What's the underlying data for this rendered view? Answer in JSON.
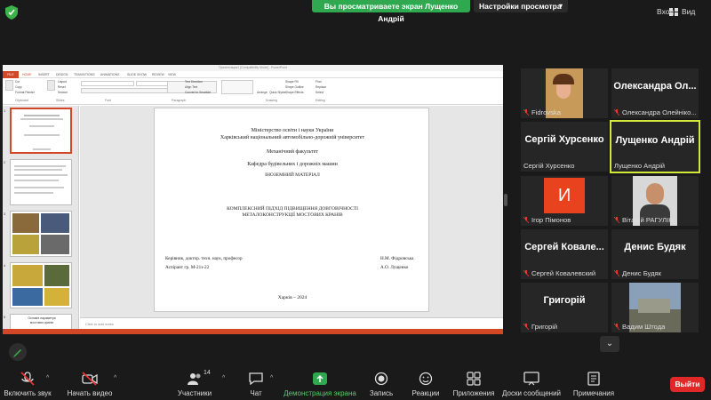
{
  "top_bar": {
    "share_banner": "Вы просматриваете экран Лущенко Андрій",
    "view_settings": "Настройки просмотра",
    "enter_label": "Вход",
    "view_label": "Вид"
  },
  "presentation": {
    "window_title": "Презентация1 [Compatibility Mode] - PowerPoint",
    "file_tab": "FILE",
    "tabs": [
      "HOME",
      "INSERT",
      "DESIGN",
      "TRANSITIONS",
      "ANIMATIONS",
      "SLIDE SHOW",
      "REVIEW",
      "VIEW"
    ],
    "ribbon_groups": [
      "Clipboard",
      "Slides",
      "Font",
      "Paragraph",
      "Drawing",
      "Editing"
    ],
    "ribbon_items": [
      "Cut",
      "Copy",
      "Format Painter",
      "Layout",
      "Reset",
      "Section",
      "Text Direction",
      "Align Text",
      "Convert to SmartArt",
      "Arrange",
      "Quick Styles",
      "Shape Fill",
      "Shape Outline",
      "Shape Effects",
      "Find",
      "Replace",
      "Select"
    ],
    "notes_placeholder": "Click to add notes",
    "slide": {
      "ministry": "Міністерство освіти і науки України",
      "university": "Харківський національний автомобільно-дорожній університет",
      "faculty": "Механічний факультет",
      "department": "Кафедра будівельних  і  дорожніх машин",
      "section": "ІНОЗЕМНИЙ МАТЕРІАЛ",
      "topic_line1": "КОМПЛЕКСНИЙ ПІДХІД ПІДВИЩЕННЯ ДОВГОВІЧНОСТІ",
      "topic_line2": "МЕТАЛОКОНСТРУКЦІЇ МОСТОВИХ КРАНІВ",
      "supervisor_label": "Керівник, доктор. техн. наук, професор",
      "supervisor_name": "Н.М. Фідровська",
      "student_label": "Аспірант гр. М-21з-22",
      "student_name": "А.О. Лущенко",
      "city_year": "Харків – 2024"
    },
    "thumbnail_numbers": [
      "1",
      "2",
      "3",
      "4",
      "5"
    ],
    "thumb5_title": "Основні параметри",
    "thumb5_subtitle": "мостових кранів"
  },
  "participants": [
    {
      "display": "",
      "name": "Fidrovska",
      "type": "photo"
    },
    {
      "display": "Олександра  Ол...",
      "name": "Олександра Олейніко...",
      "type": "name"
    },
    {
      "display": "Сергій Хурсенко",
      "name": "Сергій Хурсенко",
      "type": "name"
    },
    {
      "display": "Лущенко Андрій",
      "name": "Лущенко Андрій",
      "type": "name",
      "active": true
    },
    {
      "display": "И",
      "name": "Ігор Пімонов",
      "type": "initial"
    },
    {
      "display": "",
      "name": "Віталій РАГУЛІН",
      "type": "photo"
    },
    {
      "display": "Сергей  Ковале...",
      "name": "Сергей Ковалевский",
      "type": "name"
    },
    {
      "display": "Денис Будяк",
      "name": "Денис Будяк",
      "type": "name"
    },
    {
      "display": "Григорій",
      "name": "Григорій",
      "type": "name"
    },
    {
      "display": "",
      "name": "Вадим Штода",
      "type": "photo"
    }
  ],
  "colors": {
    "share_banner": "#2fa84f",
    "active_speaker": "#d4e83a",
    "initial_tile": "#e8421e",
    "leave_button": "#e02828",
    "powerpoint_accent": "#d24726"
  },
  "toolbar": {
    "mute": "Включить звук",
    "video": "Начать видео",
    "participants": "Участники",
    "participants_count": "14",
    "chat": "Чат",
    "share": "Демонстрация экрана",
    "record": "Запись",
    "reactions": "Реакции",
    "apps": "Приложения",
    "whiteboards": "Доски сообщений",
    "notes": "Примечания",
    "leave": "Выйти"
  }
}
